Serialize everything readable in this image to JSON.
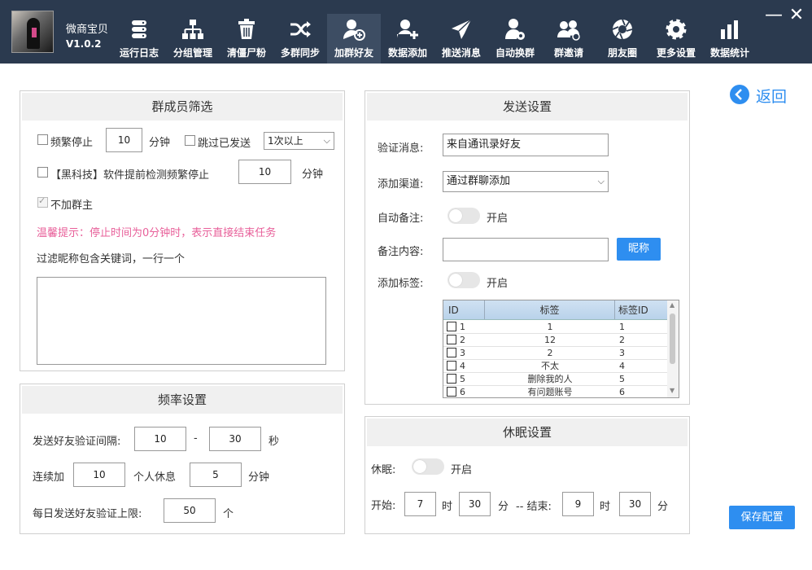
{
  "app": {
    "name": "微商宝贝",
    "version": "V1.0.2"
  },
  "nav": [
    {
      "label": "运行日志",
      "icon": "server-icon"
    },
    {
      "label": "分组管理",
      "icon": "org-chart-icon"
    },
    {
      "label": "清僵尸粉",
      "icon": "trash-icon"
    },
    {
      "label": "多群同步",
      "icon": "shuffle-icon"
    },
    {
      "label": "加群好友",
      "icon": "add-friend-icon",
      "active": true
    },
    {
      "label": "数据添加",
      "icon": "user-add-icon"
    },
    {
      "label": "推送消息",
      "icon": "send-icon"
    },
    {
      "label": "自动换群",
      "icon": "user-settings-icon"
    },
    {
      "label": "群邀请",
      "icon": "group-invite-icon"
    },
    {
      "label": "朋友圈",
      "icon": "aperture-icon"
    },
    {
      "label": "更多设置",
      "icon": "gear-icon"
    },
    {
      "label": "数据统计",
      "icon": "bar-chart-icon"
    }
  ],
  "window": {
    "minimize": "—",
    "close": "✕"
  },
  "back_label": "返回",
  "filter": {
    "title": "群成员筛选",
    "freq_stop_label": "频繁停止",
    "freq_stop_value": "10",
    "minute_unit": "分钟",
    "skip_sent_label": "跳过已发送",
    "skip_sent_option": "1次以上",
    "black_tech_label": "【黑科技】软件提前检测频繁停止",
    "black_tech_value": "10",
    "black_tech_unit": "分钟",
    "no_owner_label": "不加群主",
    "tip": "温馨提示：停止时间为0分钟时，表示直接结束任务",
    "keyword_label": "过滤昵称包含关键词，一行一个",
    "keyword_value": ""
  },
  "rate": {
    "title": "频率设置",
    "interval_label": "发送好友验证间隔:",
    "interval_min": "10",
    "dash": "-",
    "interval_max": "30",
    "sec_unit": "秒",
    "continuous_label": "连续加",
    "continuous_value": "10",
    "rest_label": "个人休息",
    "rest_value": "5",
    "rest_unit": "分钟",
    "daily_label": "每日发送好友验证上限:",
    "daily_value": "50",
    "daily_unit": "个"
  },
  "send": {
    "title": "发送设置",
    "verify_label": "验证消息:",
    "verify_value": "来自通讯录好友",
    "channel_label": "添加渠道:",
    "channel_value": "通过群聊添加",
    "auto_remark_label": "自动备注:",
    "enable_label": "开启",
    "remark_content_label": "备注内容:",
    "remark_content_value": "",
    "nickname_button": "昵称",
    "add_tag_label": "添加标签:",
    "table_headers": [
      "ID",
      "标签",
      "标签ID"
    ],
    "table_rows": [
      {
        "id": "1",
        "tag": "1",
        "tag_id": "1"
      },
      {
        "id": "2",
        "tag": "12",
        "tag_id": "2"
      },
      {
        "id": "3",
        "tag": "2",
        "tag_id": "3"
      },
      {
        "id": "4",
        "tag": "不太",
        "tag_id": "4"
      },
      {
        "id": "5",
        "tag": "删除我的人",
        "tag_id": "5"
      },
      {
        "id": "6",
        "tag": "有问题账号",
        "tag_id": "6"
      }
    ]
  },
  "sleep": {
    "title": "休眠设置",
    "sleep_label": "休眠:",
    "enable_label": "开启",
    "start_label": "开始:",
    "start_hour": "7",
    "hour_unit": "时",
    "start_min": "30",
    "min_unit": "分",
    "end_label": "-- 结束:",
    "end_hour": "9",
    "end_min": "30"
  },
  "save_button": "保存配置",
  "colors": {
    "topbar": "#2b3a4f",
    "accent": "#2e8ef0",
    "tip": "#e8609a"
  }
}
